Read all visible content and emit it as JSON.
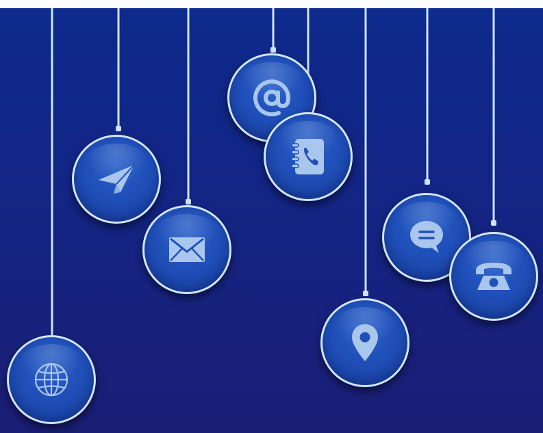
{
  "colors": {
    "background_top": "#0e2a8c",
    "background_bottom": "#1a1e74",
    "string": "#cfe4f7",
    "ring": "#d2e6f8",
    "icon": "#a9c6ec",
    "ornament_fill": "#1f4fb8"
  },
  "ornaments": [
    {
      "icon": "globe-icon"
    },
    {
      "icon": "paper-plane-icon"
    },
    {
      "icon": "envelope-icon"
    },
    {
      "icon": "at-sign-icon"
    },
    {
      "icon": "address-book-icon"
    },
    {
      "icon": "map-pin-icon"
    },
    {
      "icon": "chat-bubble-icon"
    },
    {
      "icon": "telephone-icon"
    }
  ]
}
